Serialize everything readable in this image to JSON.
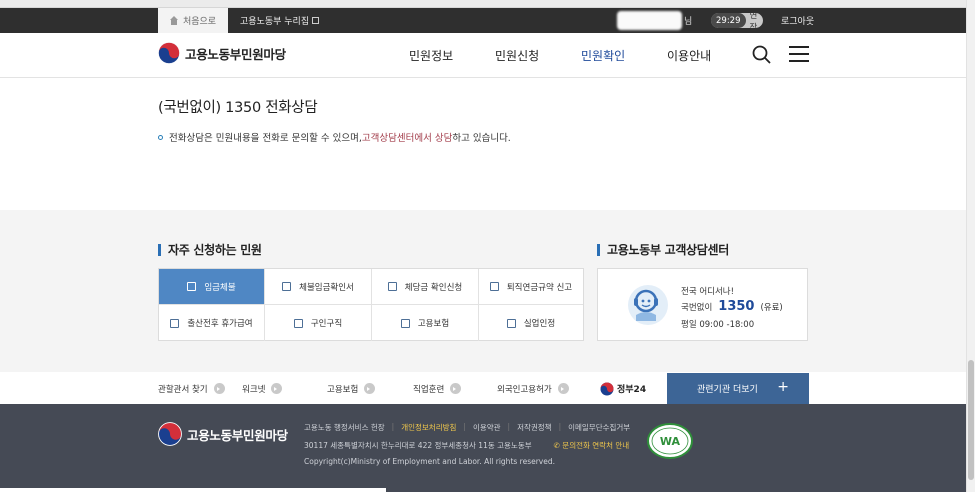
{
  "utility_bar": {
    "home_label": "처음으로",
    "nuriJip_label": "고용노동부 누리집",
    "user_suffix": "님",
    "session_time": "29:29",
    "extend_label": "연장",
    "logout_label": "로그아웃"
  },
  "header": {
    "logo_text": "고용노동부민원마당",
    "nav": [
      "민원정보",
      "민원신청",
      "민원확인",
      "이용안내"
    ],
    "active_nav": "민원확인"
  },
  "content": {
    "title": "(국번없이) 1350 전화상담",
    "desc_before": "전화상담은 민원내용을 전화로 문의할 수 있으며, ",
    "desc_highlight": "고객상담센터에서 상담",
    "desc_after": "하고 있습니다."
  },
  "frequent": {
    "title": "자주 신청하는 민원",
    "items": [
      "임금체불",
      "체불임금확인서",
      "체당금 확인신청",
      "퇴직연금규약 신고",
      "출산전후 휴가급여",
      "구인구직",
      "고용보험",
      "실업인정"
    ],
    "active_item": "임금체불"
  },
  "call_center": {
    "title": "고용노동부 고객상담센터",
    "line1": "전국 어디서나!",
    "prefix": "국번없이",
    "number": "1350",
    "fee": "(유료)",
    "hours": "평일 09:00 -18:00"
  },
  "links_bar": {
    "items": [
      "관할관서 찾기",
      "워크넷",
      "고용보험",
      "직업훈련",
      "외국인고용허가"
    ],
    "gov24": "정부24",
    "related_btn": "관련기관 더보기",
    "related_plus": "+"
  },
  "footer": {
    "logo_text": "고용노동부민원마당",
    "links": [
      "고용노동 행정서비스 헌장",
      "개인정보처리방침",
      "이용약관",
      "저작권정책",
      "이메일무단수집거부"
    ],
    "address": "30117 세종특별자치시 한누리대로 422 정부세종청사 11동 고용노동부",
    "phone_link": "문의전화 연락처 안내",
    "copyright": "Copyright(c)Ministry of Employment and Labor. All rights reserved.",
    "badge_text": "WA"
  },
  "colors": {
    "brand_blue": "#1f4a9a",
    "active_cell": "#4f87c4",
    "footer_bg": "#454a55",
    "related_btn": "#3d6596",
    "highlight_red": "#a23c4a"
  }
}
